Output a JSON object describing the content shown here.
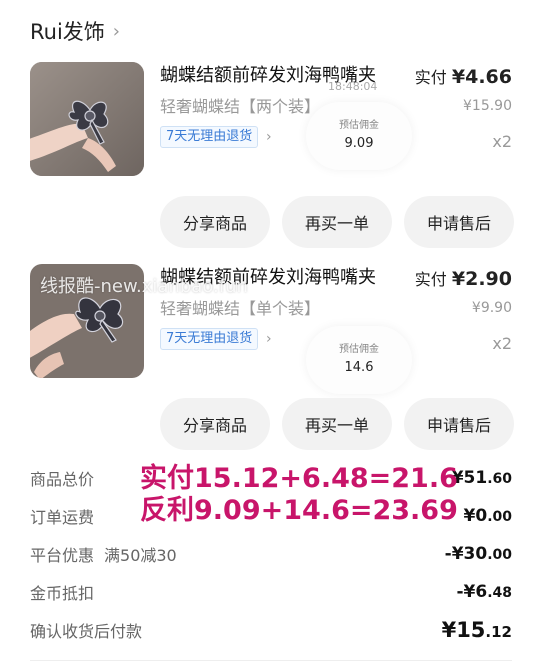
{
  "shop": {
    "name": "Rui发饰"
  },
  "items": [
    {
      "title": "蝴蝶结额前碎发刘海鸭嘴夹",
      "spec": "轻奢蝴蝶结【两个装】",
      "badge": "7天无理由退货",
      "paid_label": "实付",
      "paid_amount": "¥4.66",
      "original_price": "¥15.90",
      "quantity": "x2",
      "commission_label": "预估佣金",
      "commission_value": "9.09",
      "timestamp": "18:48:04",
      "actions": [
        "分享商品",
        "再买一单",
        "申请售后"
      ]
    },
    {
      "title": "蝴蝶结额前碎发刘海鸭嘴夹",
      "spec": "轻奢蝴蝶结【单个装】",
      "badge": "7天无理由退货",
      "paid_label": "实付",
      "paid_amount": "¥2.90",
      "original_price": "¥9.90",
      "quantity": "x2",
      "commission_label": "预估佣金",
      "commission_value": "14.6",
      "actions": [
        "分享商品",
        "再买一单",
        "申请售后"
      ]
    }
  ],
  "summary": {
    "rows": [
      {
        "label": "商品总价",
        "extra": "",
        "value_int": "¥51",
        "value_dec": ".60"
      },
      {
        "label": "订单运费",
        "extra": "",
        "value_int": "¥0",
        "value_dec": ".00"
      },
      {
        "label": "平台优惠",
        "extra": "满50减30",
        "value_int": "-¥30",
        "value_dec": ".00"
      },
      {
        "label": "金币抵扣",
        "extra": "",
        "value_int": "-¥6",
        "value_dec": ".48"
      }
    ],
    "total": {
      "label": "确认收货后付款",
      "value_int": "¥15",
      "value_dec": ".12"
    }
  },
  "annotations": {
    "line1": "实付15.12+6.48=21.6",
    "line2": "反利9.09+14.6=23.69"
  },
  "watermark": "线报酷-new.xianbao.fun",
  "colors": {
    "annotation": "#c8156a",
    "badge": "#3a7bd5",
    "button_bg": "#f2f2f2"
  }
}
